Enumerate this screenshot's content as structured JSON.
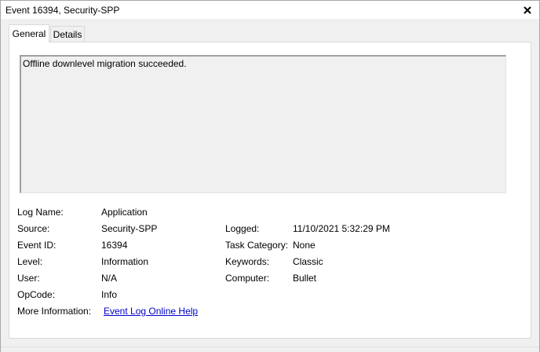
{
  "window": {
    "title": "Event 16394, Security-SPP"
  },
  "tabs": [
    {
      "label": "General",
      "active": true
    },
    {
      "label": "Details",
      "active": false
    }
  ],
  "description": "Offline downlevel migration succeeded.",
  "fields": {
    "log_name": {
      "label": "Log Name:",
      "value": "Application"
    },
    "source": {
      "label": "Source:",
      "value": "Security-SPP"
    },
    "event_id": {
      "label": "Event ID:",
      "value": "16394"
    },
    "level": {
      "label": "Level:",
      "value": "Information"
    },
    "user": {
      "label": "User:",
      "value": "N/A"
    },
    "opcode": {
      "label": "OpCode:",
      "value": "Info"
    },
    "more_info": {
      "label": "More Information:",
      "value": "Event Log Online Help"
    },
    "logged": {
      "label": "Logged:",
      "value": "11/10/2021 5:32:29 PM"
    },
    "task_category": {
      "label": "Task Category:",
      "value": "None"
    },
    "keywords": {
      "label": "Keywords:",
      "value": "Classic"
    },
    "computer": {
      "label": "Computer:",
      "value": "Bullet"
    }
  },
  "icons": {
    "close": "close-icon"
  },
  "colors": {
    "link": "#0000cc",
    "panel_bg": "#ffffff",
    "window_bg": "#f0f0f0"
  }
}
